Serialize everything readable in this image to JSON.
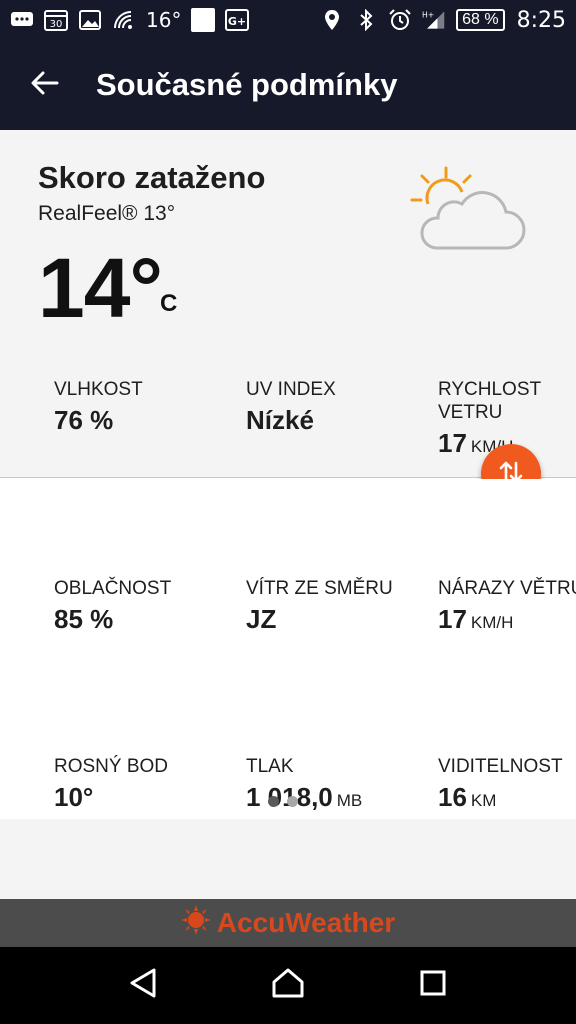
{
  "status_bar": {
    "temp": "16°",
    "calendar_day": "30",
    "network": "H+",
    "battery": "68 %",
    "time": "8:25"
  },
  "app_bar": {
    "title": "Současné podmínky"
  },
  "current": {
    "condition": "Skoro zataženo",
    "realfeel": "RealFeel® 13°",
    "temperature": "14°",
    "unit": "C",
    "icon": "partly-sunny-cloud-icon"
  },
  "details": {
    "humidity": {
      "label": "VLHKOST",
      "value": "76 %",
      "unit": ""
    },
    "uv": {
      "label": "UV INDEX",
      "value": "Nízké",
      "unit": ""
    },
    "wind_speed": {
      "label": "RYCHLOST VETRU",
      "value": "17",
      "unit": "KM/H"
    },
    "cloud_cover": {
      "label": "OBLAČNOST",
      "value": "85 %",
      "unit": ""
    },
    "wind_dir": {
      "label": "VÍTR ZE SMĚRU",
      "value": "JZ",
      "unit": ""
    },
    "gusts": {
      "label": "NÁRAZY VĚTRU",
      "value": "17",
      "unit": "KM/H"
    },
    "dew_point": {
      "label": "ROSNÝ BOD",
      "value": "10°",
      "unit": ""
    },
    "pressure": {
      "label": "TLAK",
      "value": "1 018,0",
      "unit": "MB"
    },
    "visibility": {
      "label": "VIDITELNOST",
      "value": "16",
      "unit": "KM"
    }
  },
  "footer": {
    "brand": "AccuWeather"
  },
  "colors": {
    "bar_bg": "#15192a",
    "accent": "#f05a1e",
    "sun": "#f29a1a",
    "card_bg": "#f4f4f4"
  },
  "pager": {
    "pages": 2,
    "active": 1
  }
}
